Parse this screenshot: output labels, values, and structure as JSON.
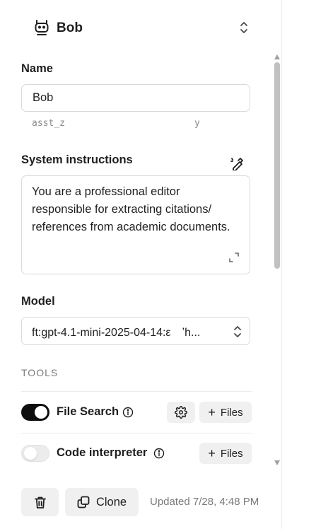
{
  "assistant": {
    "name": "Bob",
    "id_prefix": "asst_z",
    "id_suffix": "y"
  },
  "labels": {
    "name": "Name",
    "system_instructions": "System instructions",
    "model": "Model",
    "tools_header": "TOOLS"
  },
  "fields": {
    "name_value": "Bob",
    "instructions_value": "You are a professional editor responsible for extracting citations/ references from academic documents.",
    "model_value": "ft:gpt-4.1-mini-2025-04-14:ε　ʼh..."
  },
  "tools": [
    {
      "name": "File Search",
      "enabled": true,
      "files_label": "Files"
    },
    {
      "name": "Code interpreter",
      "enabled": false,
      "files_label": "Files"
    }
  ],
  "footer": {
    "clone_label": "Clone",
    "updated_text": "Updated 7/28, 4:48 PM"
  },
  "icons": [
    "bot-icon",
    "chevron-updown-icon",
    "wand-icon",
    "expand-icon",
    "info-icon",
    "gear-icon",
    "plus-icon",
    "trash-icon",
    "copy-icon"
  ],
  "colors": {
    "toggle_on": "#0d0d0d",
    "toggle_off": "#ececec",
    "button_bg": "#f0f0f0",
    "muted_text": "#7b7b7b"
  }
}
